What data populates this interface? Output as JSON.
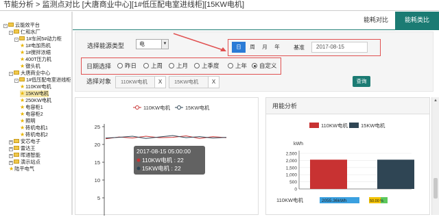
{
  "title": "节能分析 > 监测点对比 [大唐商业中心][1#低压配电室进线柜][15KW电机]",
  "tabs": [
    "能耗对比",
    "能耗类比"
  ],
  "tree": [
    {
      "t": "云能效平台",
      "lvl": 0,
      "tog": "-",
      "icon": "folder"
    },
    {
      "t": "仁和水厂",
      "lvl": 1,
      "tog": "-",
      "icon": "folder"
    },
    {
      "t": "1#车间5#动力柜",
      "lvl": 2,
      "tog": "-",
      "icon": "folder"
    },
    {
      "t": "1#电加热机",
      "lvl": 3,
      "tog": "",
      "icon": "star"
    },
    {
      "t": "1#搅拌浓缩",
      "lvl": 3,
      "tog": "",
      "icon": "star"
    },
    {
      "t": "400T压力机",
      "lvl": 3,
      "tog": "",
      "icon": "star"
    },
    {
      "t": "镦头机",
      "lvl": 3,
      "tog": "",
      "icon": "star"
    },
    {
      "t": "大唐商业中心",
      "lvl": 1,
      "tog": "-",
      "icon": "folder"
    },
    {
      "t": "1#低压配电室进线柜",
      "lvl": 2,
      "tog": "-",
      "icon": "folder"
    },
    {
      "t": "110KW电机",
      "lvl": 3,
      "tog": "",
      "icon": "star"
    },
    {
      "t": "15KW电机",
      "lvl": 3,
      "tog": "",
      "icon": "star",
      "selected": true
    },
    {
      "t": "250KW电机",
      "lvl": 3,
      "tog": "",
      "icon": "star"
    },
    {
      "t": "电容柜1",
      "lvl": 3,
      "tog": "",
      "icon": "star"
    },
    {
      "t": "电容柜2",
      "lvl": 3,
      "tog": "",
      "icon": "star"
    },
    {
      "t": "照明",
      "lvl": 3,
      "tog": "",
      "icon": "star"
    },
    {
      "t": "砖机电机1",
      "lvl": 3,
      "tog": "",
      "icon": "star"
    },
    {
      "t": "砖机电机2",
      "lvl": 3,
      "tog": "",
      "icon": "star"
    },
    {
      "t": "安芯电子",
      "lvl": 1,
      "tog": "+",
      "icon": "folder"
    },
    {
      "t": "雷达王",
      "lvl": 1,
      "tog": "+",
      "icon": "folder"
    },
    {
      "t": "晖通智能",
      "lvl": 1,
      "tog": "+",
      "icon": "folder"
    },
    {
      "t": "演示站点",
      "lvl": 1,
      "tog": "+",
      "icon": "folder"
    },
    {
      "t": "陆平电气",
      "lvl": 1,
      "tog": "",
      "icon": "star"
    }
  ],
  "filter": {
    "energy_type_label": "选择能源类型",
    "energy_type_value": "电",
    "periods": [
      "日",
      "周",
      "月",
      "年"
    ],
    "period_selected": 0,
    "base_label": "基准",
    "base_date": "2017-08-15",
    "date_label": "日期选择",
    "date_options": [
      "昨日",
      "上周",
      "上月",
      "上季度",
      "上年",
      "自定义"
    ],
    "date_selected": 5,
    "object_label": "选择对象",
    "objects": [
      "110KW电机",
      "15KW电机"
    ],
    "remove_symbol": "X",
    "query_label": "查询"
  },
  "trend_panel": {
    "legend": [
      "110KW电机",
      "15KW电机"
    ],
    "y_ticks": [
      "25",
      "20",
      "15",
      "10",
      "5"
    ],
    "tooltip_title": "2017-08-15 05:00:00",
    "tooltip_rows": [
      "110KW电机 : 22",
      "15KW电机 : 22"
    ]
  },
  "usage_panel": {
    "title": "用能分析",
    "legend": [
      "110KW电机",
      "15KW电机"
    ],
    "unit": "kWh",
    "y_ticks": [
      "2,500",
      "2,000",
      "1,500",
      "1,000",
      "500",
      "0"
    ],
    "table_label": "110KW电机",
    "table_value": "2055.36kWh",
    "table_pct": "50.00 %"
  },
  "chart_data": [
    {
      "type": "line",
      "title": "",
      "series": [
        {
          "name": "110KW电机",
          "values": [
            21.6,
            22.1,
            21.8,
            22.3,
            21.9,
            22.0,
            22.4,
            21.7,
            22.2,
            21.9
          ]
        },
        {
          "name": "15KW电机",
          "values": [
            21.8,
            22.0,
            22.3,
            21.7,
            22.1,
            22.5,
            21.9,
            22.2,
            21.8,
            22.0
          ]
        }
      ],
      "ylim": [
        0,
        25
      ]
    },
    {
      "type": "bar",
      "title": "",
      "ylabel": "kWh",
      "categories": [
        "110KW电机",
        "15KW电机"
      ],
      "values": [
        2055.36,
        2055.36
      ],
      "colors": [
        "#c83232",
        "#2f4554"
      ],
      "ylim": [
        0,
        2500
      ]
    }
  ],
  "colors": {
    "accent": "#1b7b73",
    "seg_active": "#2b7bd6",
    "bar1": "#c83232",
    "bar2": "#2f4554",
    "red_box": "#e05050"
  }
}
